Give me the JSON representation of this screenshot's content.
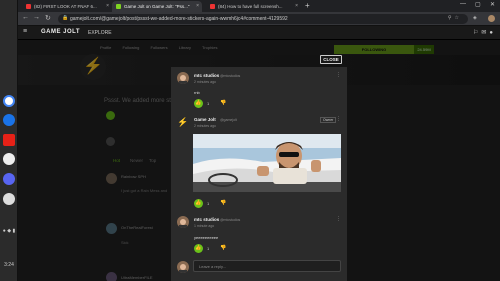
{
  "browser": {
    "tabs": [
      {
        "title": "(82) FIRST LOOK AT FNAF 6..."
      },
      {
        "title": "Game Jolt on Game Jolt: \"Pss...\""
      },
      {
        "title": "(84) How to have full screensh..."
      }
    ],
    "url": "gamejolt.com/@gamejolt/post/pssst-we-added-more-stickers-again-wwmh6jc4#comment-4129592"
  },
  "site": {
    "logo": "GAME JOLT",
    "explore": "EXPLORE",
    "profile_tabs": [
      "Profile",
      "Following",
      "Followers",
      "Library",
      "Trophies"
    ],
    "following_button": "FOLLOWING",
    "follower_count": "24.59M"
  },
  "background": {
    "post_title": "Pssst. We added more stic",
    "sort_tabs": [
      "Hot",
      "Newer",
      "Top"
    ],
    "comments": [
      {
        "name": "Rainbow SPH",
        "text": "I just got a Rain Mess and"
      },
      {
        "name": "OnTheRealForest",
        "text": "Sick"
      },
      {
        "name": "UltraMemberFILE",
        "text": ""
      }
    ]
  },
  "modal": {
    "close_label": "CLOSE",
    "comments": [
      {
        "name": "mtc studios",
        "handle": "@mtcstudios",
        "time": "2 minutes ago",
        "body": "rnb",
        "likes": "1"
      },
      {
        "name": "Game Jolt",
        "handle": "@gamejolt",
        "time": "2 minutes ago",
        "badge": "Owner",
        "likes": "1"
      },
      {
        "name": "mtc studios",
        "handle": "@mtcstudios",
        "time": "1 minute ago",
        "body": "yeeeeeeeeee",
        "likes": "1"
      }
    ],
    "reply_placeholder": "Leave a reply..."
  },
  "os": {
    "time": "3:24"
  },
  "colors": {
    "accent_green": "#6bc11a",
    "page_bg": "#232323",
    "modal_bg": "#2b2b2b"
  }
}
